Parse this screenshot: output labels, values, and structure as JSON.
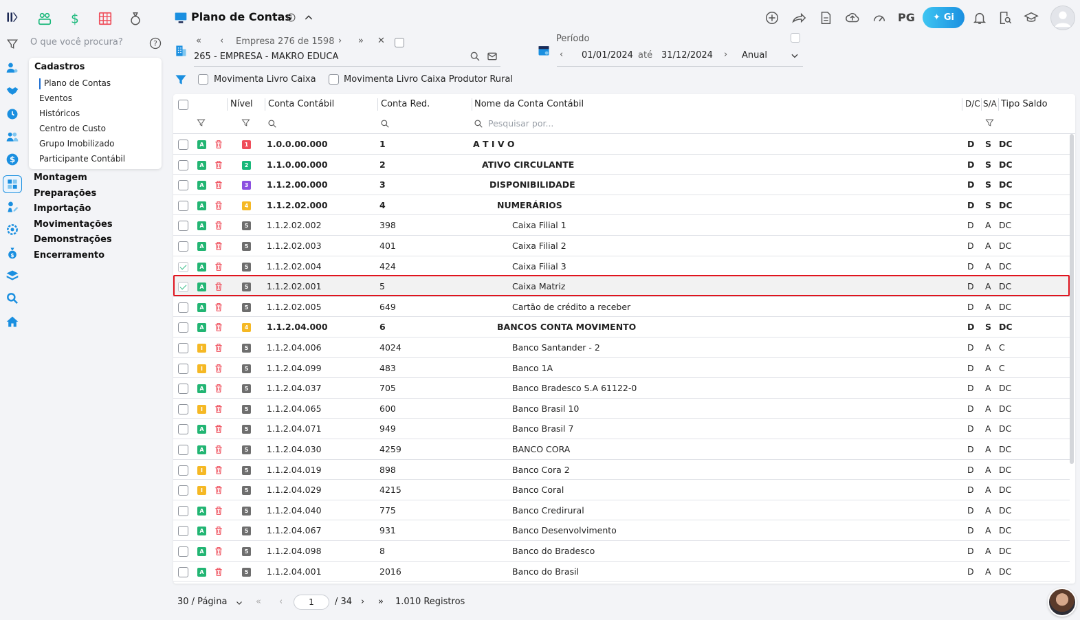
{
  "search": {
    "placeholder": "O que você procura?"
  },
  "menu": {
    "cadastros_title": "Cadastros",
    "cadastros_items": [
      "Plano de Contas",
      "Eventos",
      "Históricos",
      "Centro de Custo",
      "Grupo Imobilizado",
      "Participante Contábil"
    ],
    "sections": [
      "Montagem",
      "Preparações",
      "Importação",
      "Movimentações",
      "Demonstrações",
      "Encerramento"
    ]
  },
  "header": {
    "title": "Plano de Contas",
    "pg": "PG",
    "gi": "Gi"
  },
  "empresa": {
    "counter": "Empresa 276 de 1598",
    "name": "265 - EMPRESA - MAKRO EDUCA"
  },
  "periodo": {
    "label": "Período",
    "start": "01/01/2024",
    "ate": "até",
    "end": "31/12/2024",
    "type": "Anual"
  },
  "filters": {
    "livro_caixa": "Movimenta Livro Caixa",
    "livro_produtor": "Movimenta Livro Caixa Produtor Rural"
  },
  "table": {
    "headers": {
      "nivel": "Nível",
      "conta": "Conta Contábil",
      "red": "Conta Red.",
      "nome": "Nome da Conta Contábil",
      "dc": "D/C",
      "sa": "S/A",
      "tipo": "Tipo Saldo",
      "search_placeholder": "Pesquisar por..."
    },
    "rows": [
      {
        "status": "A",
        "level": "1",
        "conta": "1.0.0.00.000",
        "red": "1",
        "nome": "A T I V O",
        "indent": 0,
        "dc": "D",
        "sa": "S",
        "tipo": "DC",
        "bold": true,
        "checked": false
      },
      {
        "status": "A",
        "level": "2",
        "conta": "1.1.0.00.000",
        "red": "2",
        "nome": "ATIVO CIRCULANTE",
        "indent": 1,
        "dc": "D",
        "sa": "S",
        "tipo": "DC",
        "bold": true,
        "checked": false
      },
      {
        "status": "A",
        "level": "3",
        "conta": "1.1.2.00.000",
        "red": "3",
        "nome": "DISPONIBILIDADE",
        "indent": 2,
        "dc": "D",
        "sa": "S",
        "tipo": "DC",
        "bold": true,
        "checked": false
      },
      {
        "status": "A",
        "level": "4",
        "conta": "1.1.2.02.000",
        "red": "4",
        "nome": "NUMERÁRIOS",
        "indent": 3,
        "dc": "D",
        "sa": "S",
        "tipo": "DC",
        "bold": true,
        "checked": false
      },
      {
        "status": "A",
        "level": "5",
        "conta": "1.1.2.02.002",
        "red": "398",
        "nome": "Caixa Filial 1",
        "indent": 4,
        "dc": "D",
        "sa": "A",
        "tipo": "DC",
        "bold": false,
        "checked": false
      },
      {
        "status": "A",
        "level": "5",
        "conta": "1.1.2.02.003",
        "red": "401",
        "nome": "Caixa Filial 2",
        "indent": 4,
        "dc": "D",
        "sa": "A",
        "tipo": "DC",
        "bold": false,
        "checked": false
      },
      {
        "status": "A",
        "level": "5",
        "conta": "1.1.2.02.004",
        "red": "424",
        "nome": "Caixa Filial 3",
        "indent": 4,
        "dc": "D",
        "sa": "A",
        "tipo": "DC",
        "bold": false,
        "checked": true
      },
      {
        "status": "A",
        "level": "5",
        "conta": "1.1.2.02.001",
        "red": "5",
        "nome": "Caixa Matriz",
        "indent": 4,
        "dc": "D",
        "sa": "A",
        "tipo": "DC",
        "bold": false,
        "checked": true,
        "selected": true
      },
      {
        "status": "A",
        "level": "5",
        "conta": "1.1.2.02.005",
        "red": "649",
        "nome": "Cartão de crédito a receber",
        "indent": 4,
        "dc": "D",
        "sa": "A",
        "tipo": "DC",
        "bold": false,
        "checked": false
      },
      {
        "status": "A",
        "level": "4",
        "conta": "1.1.2.04.000",
        "red": "6",
        "nome": "BANCOS CONTA MOVIMENTO",
        "indent": 3,
        "dc": "D",
        "sa": "S",
        "tipo": "DC",
        "bold": true,
        "checked": false
      },
      {
        "status": "I",
        "level": "5",
        "conta": "1.1.2.04.006",
        "red": "4024",
        "nome": "Banco Santander - 2",
        "indent": 4,
        "dc": "D",
        "sa": "A",
        "tipo": "C",
        "bold": false,
        "checked": false
      },
      {
        "status": "I",
        "level": "5",
        "conta": "1.1.2.04.099",
        "red": "483",
        "nome": "Banco 1A",
        "indent": 4,
        "dc": "D",
        "sa": "A",
        "tipo": "C",
        "bold": false,
        "checked": false
      },
      {
        "status": "A",
        "level": "5",
        "conta": "1.1.2.04.037",
        "red": "705",
        "nome": "Banco Bradesco S.A 61122-0",
        "indent": 4,
        "dc": "D",
        "sa": "A",
        "tipo": "DC",
        "bold": false,
        "checked": false
      },
      {
        "status": "I",
        "level": "5",
        "conta": "1.1.2.04.065",
        "red": "600",
        "nome": "Banco Brasil 10",
        "indent": 4,
        "dc": "D",
        "sa": "A",
        "tipo": "DC",
        "bold": false,
        "checked": false
      },
      {
        "status": "A",
        "level": "5",
        "conta": "1.1.2.04.071",
        "red": "949",
        "nome": "Banco Brasil 7",
        "indent": 4,
        "dc": "D",
        "sa": "A",
        "tipo": "DC",
        "bold": false,
        "checked": false
      },
      {
        "status": "A",
        "level": "5",
        "conta": "1.1.2.04.030",
        "red": "4259",
        "nome": "BANCO CORA",
        "indent": 4,
        "dc": "D",
        "sa": "A",
        "tipo": "DC",
        "bold": false,
        "checked": false
      },
      {
        "status": "I",
        "level": "5",
        "conta": "1.1.2.04.019",
        "red": "898",
        "nome": "Banco Cora 2",
        "indent": 4,
        "dc": "D",
        "sa": "A",
        "tipo": "DC",
        "bold": false,
        "checked": false
      },
      {
        "status": "I",
        "level": "5",
        "conta": "1.1.2.04.029",
        "red": "4215",
        "nome": "Banco Coral",
        "indent": 4,
        "dc": "D",
        "sa": "A",
        "tipo": "DC",
        "bold": false,
        "checked": false
      },
      {
        "status": "A",
        "level": "5",
        "conta": "1.1.2.04.040",
        "red": "775",
        "nome": "Banco Credirural",
        "indent": 4,
        "dc": "D",
        "sa": "A",
        "tipo": "DC",
        "bold": false,
        "checked": false
      },
      {
        "status": "A",
        "level": "5",
        "conta": "1.1.2.04.067",
        "red": "931",
        "nome": "Banco Desenvolvimento",
        "indent": 4,
        "dc": "D",
        "sa": "A",
        "tipo": "DC",
        "bold": false,
        "checked": false
      },
      {
        "status": "A",
        "level": "5",
        "conta": "1.1.2.04.098",
        "red": "8",
        "nome": "Banco do Bradesco",
        "indent": 4,
        "dc": "D",
        "sa": "A",
        "tipo": "DC",
        "bold": false,
        "checked": false
      },
      {
        "status": "A",
        "level": "5",
        "conta": "1.1.2.04.001",
        "red": "2016",
        "nome": "Banco do Brasil",
        "indent": 4,
        "dc": "D",
        "sa": "A",
        "tipo": "DC",
        "bold": false,
        "checked": false
      }
    ]
  },
  "pagination": {
    "per_page": "30 / Página",
    "current": "1",
    "total": "/ 34",
    "records": "1.010 Registros"
  },
  "colors": {
    "status_A": "#22b573",
    "status_I": "#f5b824",
    "level_1": "#ef4d5a",
    "level_2": "#18b87a",
    "level_3": "#8b4fe0",
    "level_4": "#f5b824",
    "level_5": "#6e6e6e",
    "highlight": "#e0141e",
    "accent": "#1a8fe0"
  }
}
